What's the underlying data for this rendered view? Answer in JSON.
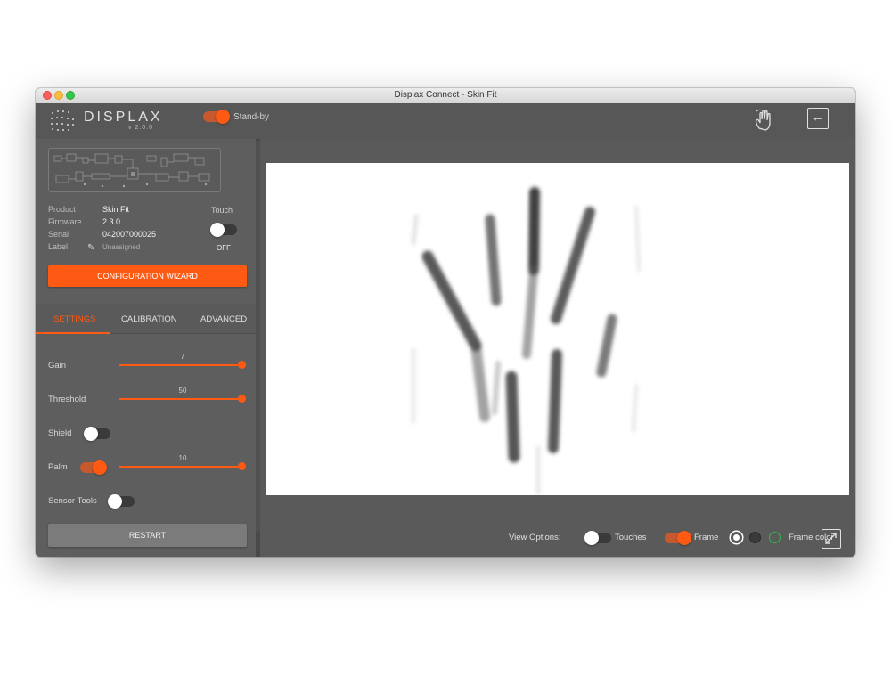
{
  "window": {
    "title": "Displax Connect - Skin Fit"
  },
  "header": {
    "logo_text": "DISPLAX",
    "version": "v 2.0.0",
    "standby_label": "Stand-by",
    "standby_on": true
  },
  "device": {
    "labels": {
      "product": "Product",
      "firmware": "Firmware",
      "serial": "Serial",
      "label": "Label"
    },
    "product": "Skin Fit",
    "firmware": "2.3.0",
    "serial": "042007000025",
    "label_value": "Unassigned",
    "touch_title": "Touch",
    "touch_state": "OFF"
  },
  "config_wizard_label": "CONFIGURATION WIZARD",
  "tabs": [
    {
      "label": "SETTINGS",
      "active": true
    },
    {
      "label": "CALIBRATION",
      "active": false
    },
    {
      "label": "ADVANCED",
      "active": false
    }
  ],
  "settings": {
    "gain": {
      "label": "Gain",
      "value": "7"
    },
    "threshold": {
      "label": "Threshold",
      "value": "50"
    },
    "shield": {
      "label": "Shield",
      "on": false
    },
    "palm": {
      "label": "Palm",
      "on": true,
      "value": "10"
    },
    "sensor_tools": {
      "label": "Sensor Tools",
      "on": false
    }
  },
  "restart_label": "RESTART",
  "view_options": {
    "label": "View Options:",
    "touches_label": "Touches",
    "touches_on": false,
    "frame_label": "Frame",
    "frame_on": true,
    "frame_color_label": "Frame color",
    "frame_colors": [
      "#ffffff",
      "#333333",
      "#2fb84a"
    ],
    "selected_color": "#ffffff"
  },
  "colors": {
    "accent": "#ff5a14",
    "panel": "#575757",
    "sidebar": "#5e5e5e"
  }
}
